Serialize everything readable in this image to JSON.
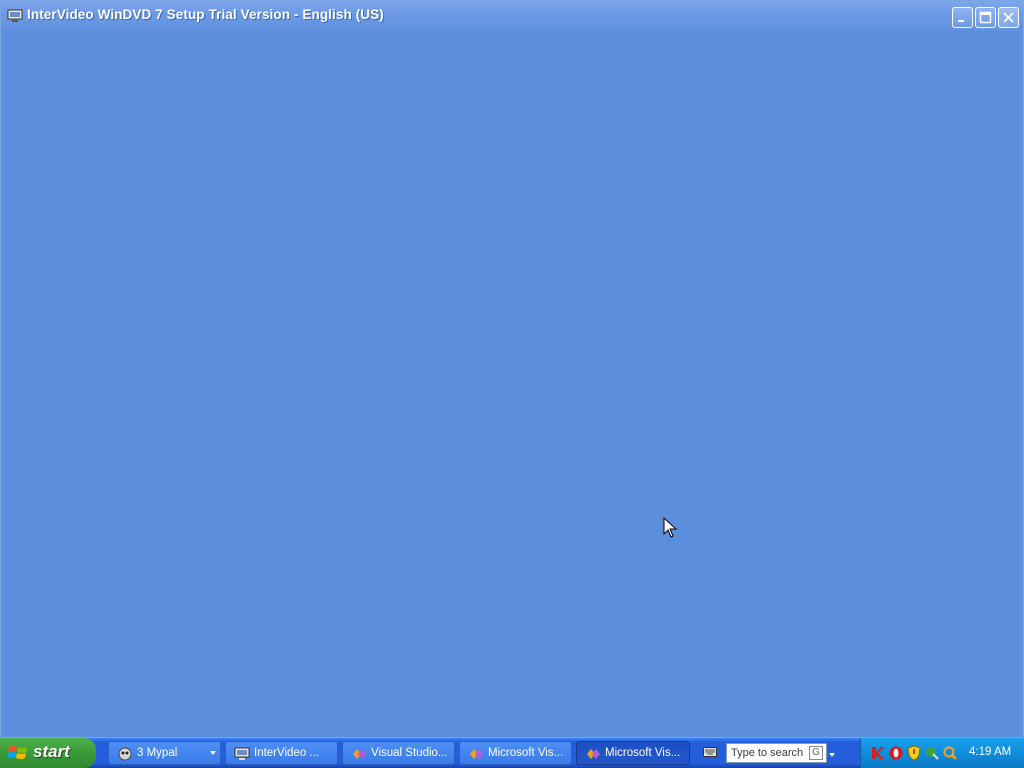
{
  "window": {
    "title": "InterVideo WinDVD 7 Setup Trial Version - English (US)",
    "bg_color": "#5b8edb",
    "controls": {
      "minimize_icon": "minimize-icon",
      "maximize_icon": "maximize-icon",
      "close_icon": "close-icon"
    }
  },
  "taskbar": {
    "start_label": "start",
    "tasks": [
      {
        "label": "3 Mypal",
        "icon": "mypal-icon",
        "has_dropdown": true
      },
      {
        "label": "InterVideo ...",
        "icon": "setup-window-icon"
      },
      {
        "label": "Visual Studio...",
        "icon": "visual-studio-icon"
      },
      {
        "label": "Microsoft Vis...",
        "icon": "visual-studio-icon"
      },
      {
        "label": "Microsoft Vis...",
        "icon": "visual-studio-icon",
        "active": true
      }
    ],
    "search_placeholder": "Type to search",
    "search_engine_glyph": "G",
    "tray_icons": [
      "kaspersky-icon",
      "opera-icon",
      "security-shield-icon",
      "network-icon",
      "search-tray-icon"
    ],
    "clock": "4:19 AM"
  }
}
